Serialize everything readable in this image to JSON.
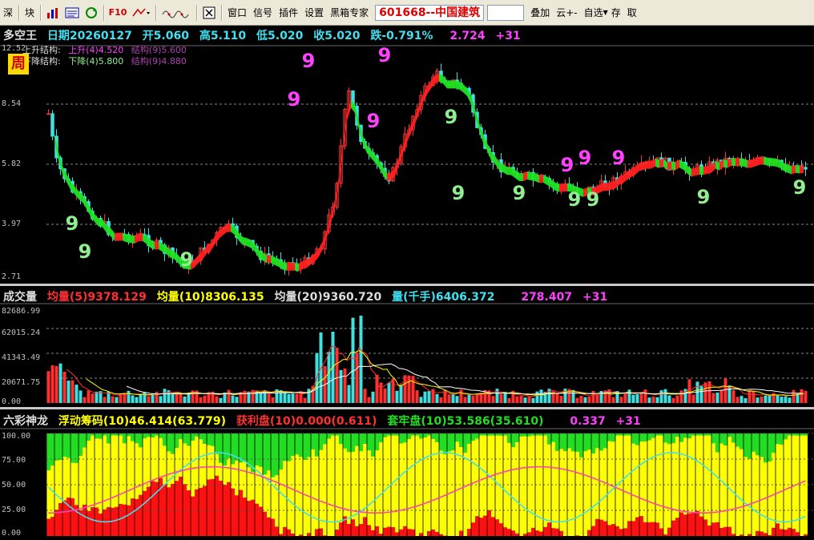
{
  "toolbar": {
    "items_left": [
      "深",
      "块"
    ],
    "items_menu": [
      "窗口",
      "信号",
      "插件",
      "设置",
      "黑箱专家"
    ],
    "stock": "601668--中国建筑",
    "items_right": [
      "叠加",
      "云+-",
      "自选",
      "存",
      "取"
    ],
    "icon_names": [
      "bar-chart-icon",
      "quote-icon",
      "refresh-icon",
      "f10-icon",
      "draw-icon",
      "wave-icon",
      "close-box-icon"
    ],
    "f10_label": "F10"
  },
  "main": {
    "title": "多空王",
    "date": "日期20260127",
    "open": "开5.060",
    "high": "高5.110",
    "low": "低5.020",
    "close": "收5.020",
    "change": "跌-0.791%",
    "value": "2.724",
    "count": "+31",
    "period": "周",
    "up_label": "上升结构:",
    "up_a": "上升(4)4.520",
    "up_b": "结构(9)5.600",
    "down_label": "下降结构:",
    "down_a": "下降(4)5.800",
    "down_b": "结构(9)4.880",
    "y_labels": [
      "12.52",
      "8.54",
      "5.82",
      "3.97",
      "2.71"
    ]
  },
  "volume": {
    "title": "成交量",
    "ma5": "均量(5)9378.129",
    "ma10": "均量(10)8306.135",
    "ma20": "均量(20)9360.720",
    "qty": "量(千手)6406.372",
    "value": "278.407",
    "count": "+31",
    "y_labels": [
      "82686.99",
      "62015.24",
      "41343.49",
      "20671.75",
      "0.00"
    ]
  },
  "chips": {
    "title": "六彩神龙",
    "float": "浮动筹码(10)46.414(63.779)",
    "profit": "获利盘(10)0.000(0.611)",
    "trapped": "套牢盘(10)53.586(35.610)",
    "value": "0.337",
    "count": "+31",
    "y_labels": [
      "100.00",
      "75.00",
      "50.00",
      "25.00",
      "0.00"
    ]
  },
  "chart_data": {
    "type": "candlestick",
    "nine_markers": [
      "9",
      "9",
      "9",
      "9",
      "9",
      "9",
      "9",
      "9",
      "9",
      "9",
      "9",
      "9",
      "9",
      "9",
      "9",
      "9",
      "9"
    ],
    "price_axis": {
      "ticks": [
        12.52,
        8.54,
        5.82,
        3.97,
        2.71
      ],
      "scale": "log"
    },
    "volume_axis": {
      "ticks": [
        82686.99,
        62015.24,
        41343.49,
        20671.75,
        0.0
      ]
    },
    "chip_axis": {
      "ticks": [
        100,
        75,
        50,
        25,
        0
      ]
    },
    "colors": {
      "up": "#ff3030",
      "down": "#40e0e0",
      "ribbon_up": "#ff2020",
      "ribbon_down": "#20e020",
      "nine_magenta": "#ff40ff",
      "nine_green": "#90ee90",
      "yellow": "#ffff00",
      "green_fill": "#22dd22",
      "red_fill": "#ff1010",
      "cyan_line": "#40e0f0",
      "magenta_line": "#ff40c0"
    }
  }
}
